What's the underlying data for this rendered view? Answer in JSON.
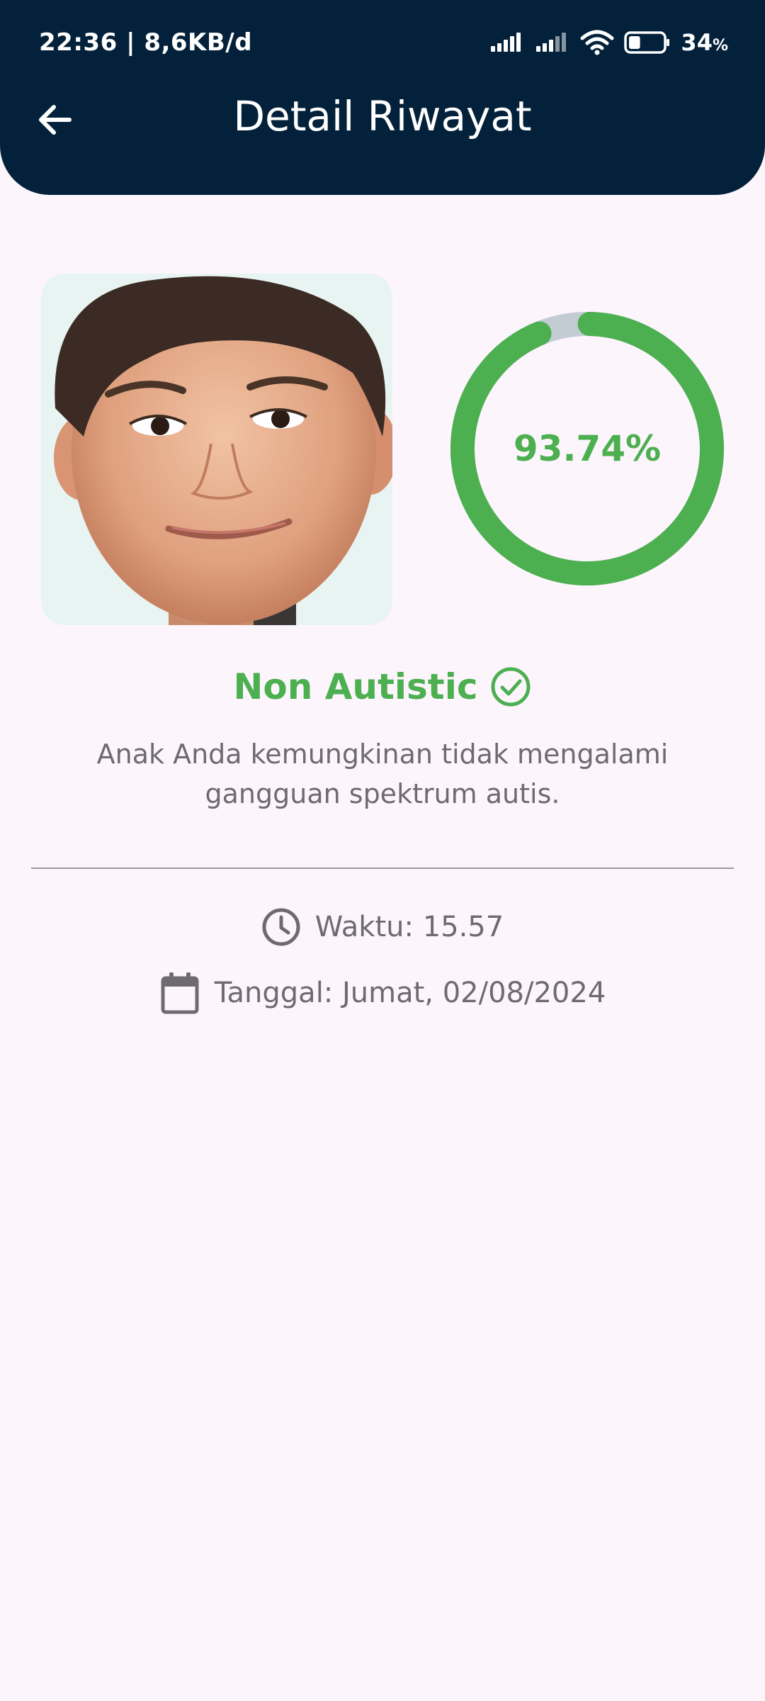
{
  "status_bar": {
    "time_speed": "22:36 | 8,6KB/d",
    "battery_percent": "34",
    "battery_unit": "%",
    "battery_level": 0.34,
    "icons": [
      "signal-icon",
      "signal-icon",
      "wifi-icon",
      "battery-icon"
    ]
  },
  "app_bar": {
    "title": "Detail Riwayat",
    "back_icon": "arrow-left-icon",
    "background": "#03213A"
  },
  "result": {
    "confidence_label": "93.74%",
    "confidence_value": 93.74,
    "label": "Non Autistic",
    "label_icon": "check-circle-icon",
    "description": "Anak Anda kemungkinan tidak mengalami gangguan spektrum autis.",
    "accent_color": "#4CAF50",
    "track_color": "#C3CBD3"
  },
  "details": {
    "time_text": "Waktu: 15.57",
    "time_icon": "clock-icon",
    "date_text": "Tanggal: Jumat, 02/08/2024",
    "date_icon": "calendar-icon"
  }
}
